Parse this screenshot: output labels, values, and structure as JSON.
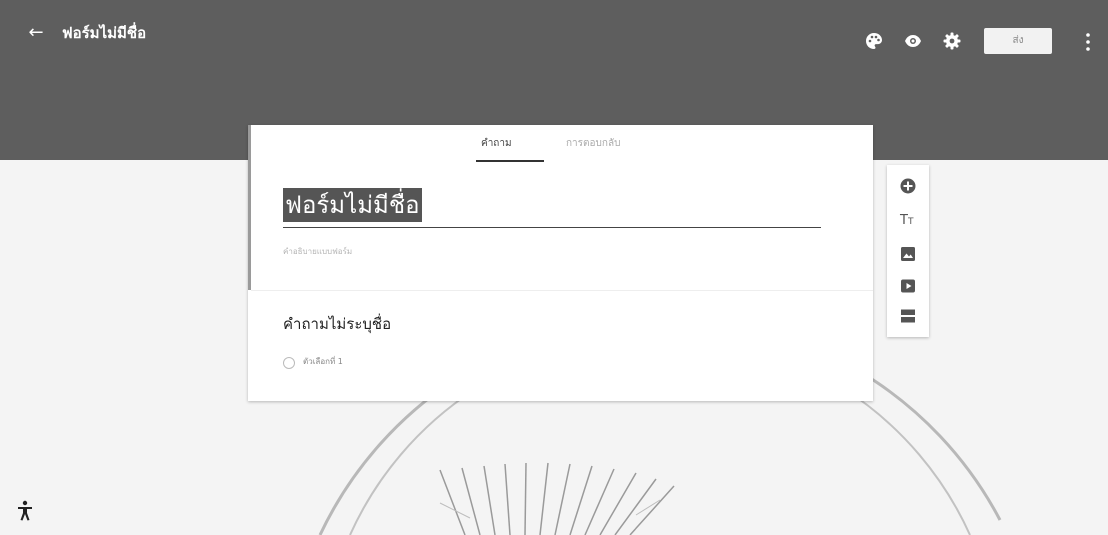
{
  "header": {
    "title": "ฟอร์มไม่มีชื่อ",
    "send_label": "ส่ง"
  },
  "icons": {
    "back": "arrow-left-icon",
    "palette": "palette-icon",
    "preview": "eye-icon",
    "settings": "gear-icon",
    "more": "more-vert-icon",
    "add_question": "add-circle-icon",
    "add_title": "text-title-icon",
    "add_image": "image-icon",
    "add_video": "video-icon",
    "add_section": "section-icon",
    "accessibility": "accessibility-icon"
  },
  "tabs": {
    "questions": "คำถาม",
    "responses": "การตอบกลับ"
  },
  "form": {
    "title": "ฟอร์มไม่มีชื่อ",
    "description_placeholder": "คำอธิบายแบบฟอร์ม"
  },
  "question": {
    "title": "คำถามไม่ระบุชื่อ",
    "option_1": "ตัวเลือกที่ 1"
  },
  "colors": {
    "header_bg": "#5e5e5e",
    "page_bg": "#f4f4f4",
    "card_bg": "#ffffff"
  }
}
